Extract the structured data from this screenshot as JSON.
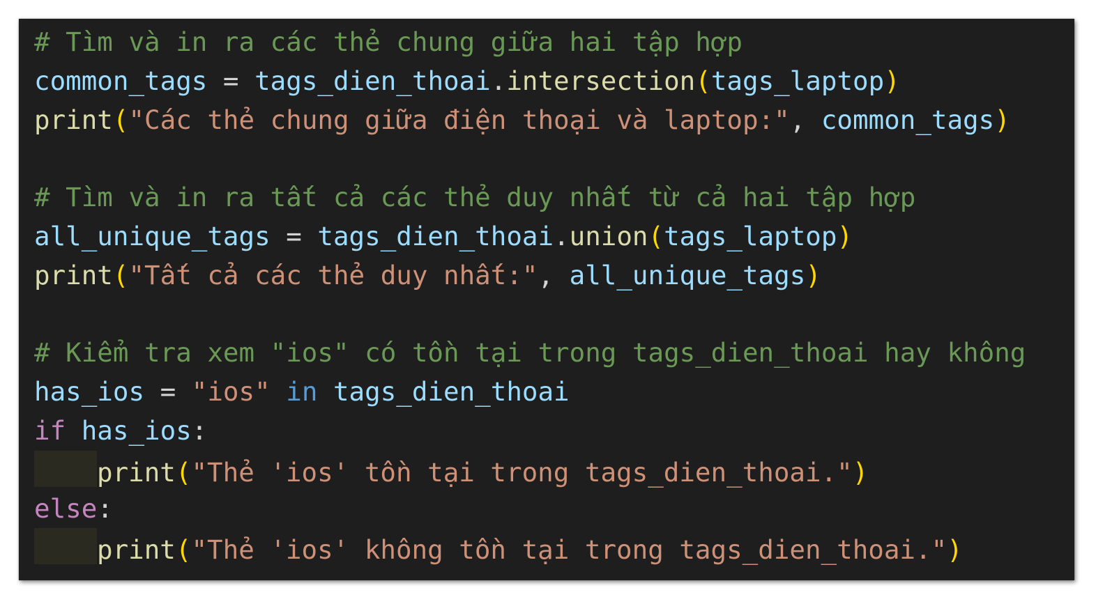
{
  "editor": {
    "theme": {
      "background": "#1e1e1e",
      "comment": "#6a9955",
      "variable": "#9cdcfe",
      "function": "#dcdcaa",
      "string": "#ce9178",
      "bracket": "#ffd700",
      "keyword": "#569cd6",
      "control": "#c586c0",
      "default": "#d4d4d4",
      "indent_highlight": "#2b2a20"
    },
    "lines": [
      {
        "tokens": [
          {
            "t": "comment",
            "v": "# Tìm và in ra các thẻ chung giữa hai tập hợp"
          }
        ]
      },
      {
        "tokens": [
          {
            "t": "var",
            "v": "common_tags"
          },
          {
            "t": "op",
            "v": " = "
          },
          {
            "t": "var",
            "v": "tags_dien_thoai"
          },
          {
            "t": "punct",
            "v": "."
          },
          {
            "t": "func",
            "v": "intersection"
          },
          {
            "t": "paren",
            "v": "("
          },
          {
            "t": "var",
            "v": "tags_laptop"
          },
          {
            "t": "paren",
            "v": ")"
          }
        ]
      },
      {
        "tokens": [
          {
            "t": "func",
            "v": "print"
          },
          {
            "t": "paren",
            "v": "("
          },
          {
            "t": "string",
            "v": "\"Các thẻ chung giữa điện thoại và laptop:\""
          },
          {
            "t": "punct",
            "v": ", "
          },
          {
            "t": "var",
            "v": "common_tags"
          },
          {
            "t": "paren",
            "v": ")"
          }
        ]
      },
      {
        "tokens": []
      },
      {
        "tokens": [
          {
            "t": "comment",
            "v": "# Tìm và in ra tất cả các thẻ duy nhất từ cả hai tập hợp"
          }
        ]
      },
      {
        "tokens": [
          {
            "t": "var",
            "v": "all_unique_tags"
          },
          {
            "t": "op",
            "v": " = "
          },
          {
            "t": "var",
            "v": "tags_dien_thoai"
          },
          {
            "t": "punct",
            "v": "."
          },
          {
            "t": "func",
            "v": "union"
          },
          {
            "t": "paren",
            "v": "("
          },
          {
            "t": "var",
            "v": "tags_laptop"
          },
          {
            "t": "paren",
            "v": ")"
          }
        ]
      },
      {
        "tokens": [
          {
            "t": "func",
            "v": "print"
          },
          {
            "t": "paren",
            "v": "("
          },
          {
            "t": "string",
            "v": "\"Tất cả các thẻ duy nhất:\""
          },
          {
            "t": "punct",
            "v": ", "
          },
          {
            "t": "var",
            "v": "all_unique_tags"
          },
          {
            "t": "paren",
            "v": ")"
          }
        ]
      },
      {
        "tokens": []
      },
      {
        "tokens": [
          {
            "t": "comment",
            "v": "# Kiểm tra xem \"ios\" có tồn tại trong tags_dien_thoai hay không"
          }
        ]
      },
      {
        "tokens": [
          {
            "t": "var",
            "v": "has_ios"
          },
          {
            "t": "op",
            "v": " = "
          },
          {
            "t": "string",
            "v": "\"ios\""
          },
          {
            "t": "op",
            "v": " "
          },
          {
            "t": "keyword",
            "v": "in"
          },
          {
            "t": "op",
            "v": " "
          },
          {
            "t": "var",
            "v": "tags_dien_thoai"
          }
        ]
      },
      {
        "tokens": [
          {
            "t": "control",
            "v": "if"
          },
          {
            "t": "op",
            "v": " "
          },
          {
            "t": "var",
            "v": "has_ios"
          },
          {
            "t": "punct",
            "v": ":"
          }
        ]
      },
      {
        "indent": true,
        "tokens": [
          {
            "t": "func",
            "v": "print"
          },
          {
            "t": "paren",
            "v": "("
          },
          {
            "t": "string",
            "v": "\"Thẻ 'ios' tồn tại trong tags_dien_thoai.\""
          },
          {
            "t": "paren",
            "v": ")"
          }
        ]
      },
      {
        "tokens": [
          {
            "t": "control",
            "v": "else"
          },
          {
            "t": "punct",
            "v": ":"
          }
        ]
      },
      {
        "indent": true,
        "tokens": [
          {
            "t": "func",
            "v": "print"
          },
          {
            "t": "paren",
            "v": "("
          },
          {
            "t": "string",
            "v": "\"Thẻ 'ios' không tồn tại trong tags_dien_thoai.\""
          },
          {
            "t": "paren",
            "v": ")"
          }
        ]
      }
    ]
  }
}
